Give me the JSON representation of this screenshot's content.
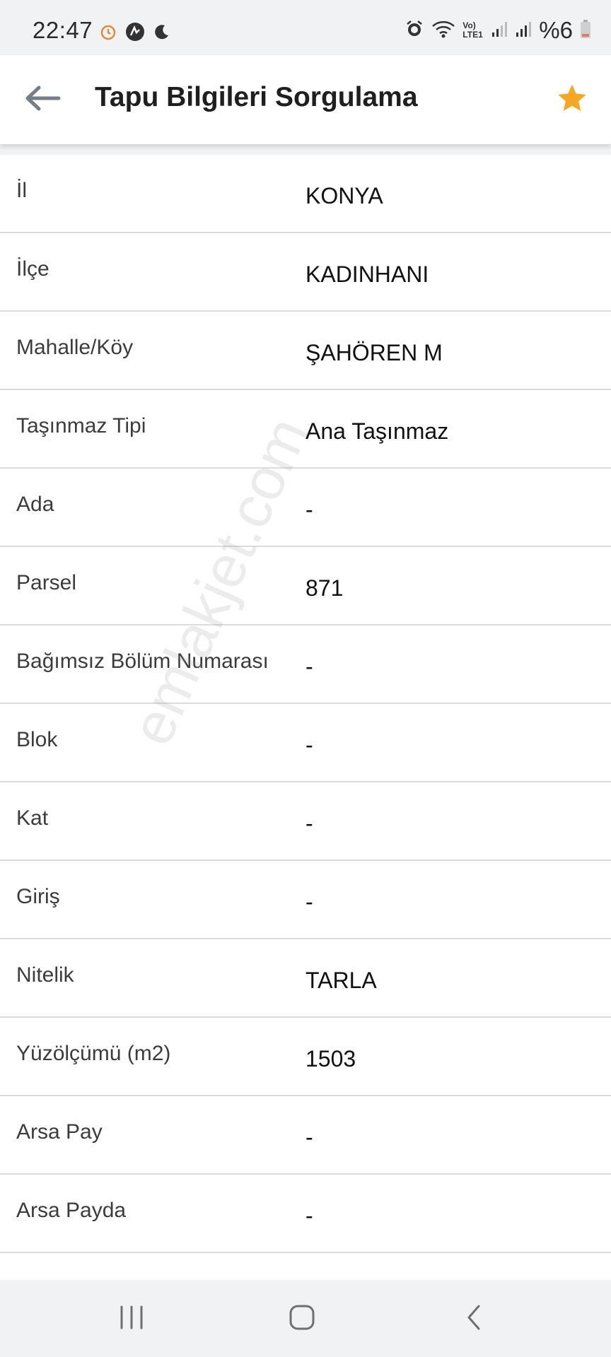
{
  "status_bar": {
    "time": "22:47",
    "battery_text": "%6",
    "network_label": "Vo) LTE1",
    "icons": [
      "alarm-clock-icon",
      "activity-icon",
      "do-not-disturb-moon-icon",
      "alarm-icon",
      "wifi-icon",
      "signal-icon",
      "signal-icon",
      "battery-icon"
    ]
  },
  "app_bar": {
    "title": "Tapu Bilgileri Sorgulama",
    "back_icon": "arrow-left-icon",
    "favorite_icon": "star-icon",
    "accent_color": "#f5a623"
  },
  "details": [
    {
      "label": "İl",
      "value": "KONYA"
    },
    {
      "label": "İlçe",
      "value": "KADINHANI"
    },
    {
      "label": "Mahalle/Köy",
      "value": "ŞAHÖREN M"
    },
    {
      "label": "Taşınmaz Tipi",
      "value": "Ana Taşınmaz"
    },
    {
      "label": "Ada",
      "value": "-"
    },
    {
      "label": "Parsel",
      "value": "871"
    },
    {
      "label": "Bağımsız Bölüm Numarası",
      "value": "-"
    },
    {
      "label": "Blok",
      "value": "-"
    },
    {
      "label": "Kat",
      "value": "-"
    },
    {
      "label": "Giriş",
      "value": "-"
    },
    {
      "label": "Nitelik",
      "value": "TARLA"
    },
    {
      "label": "Yüzölçümü (m2)",
      "value": "1503"
    },
    {
      "label": "Arsa Pay",
      "value": "-"
    },
    {
      "label": "Arsa Payda",
      "value": "-"
    }
  ],
  "watermark": "emlakjet.com",
  "nav_bar": {
    "icons": [
      "recent-apps-icon",
      "home-icon",
      "back-chevron-icon"
    ]
  }
}
